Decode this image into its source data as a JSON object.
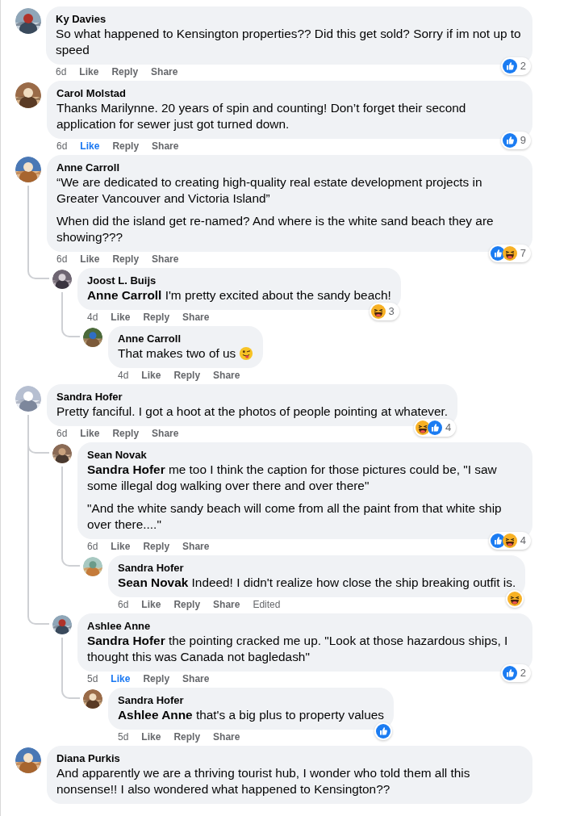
{
  "comments": [
    {
      "author": "Ky Davies",
      "paragraphs": [
        "So what happened to Kensington properties?? Did this get sold? Sorry if im not up to speed"
      ],
      "time": "6d",
      "like": "Like",
      "liked": false,
      "reply": "Reply",
      "share": "Share",
      "reactions": {
        "icons": [
          {
            "kind": "like"
          }
        ],
        "count": "2"
      }
    },
    {
      "author": "Carol Molstad",
      "paragraphs": [
        "Thanks Marilynne. 20 years of spin and counting! Don’t forget their second application for sewer just got turned down."
      ],
      "time": "6d",
      "like": "Like",
      "liked": true,
      "reply": "Reply",
      "share": "Share",
      "reactions": {
        "icons": [
          {
            "kind": "like"
          }
        ],
        "count": "9"
      }
    },
    {
      "author": "Anne Carroll",
      "paragraphs": [
        "“We are dedicated to creating high-quality real estate development projects in Greater Vancouver and Victoria Island”",
        "When did the island get re-named? And where is the white sand beach they are showing???"
      ],
      "time": "6d",
      "like": "Like",
      "liked": false,
      "reply": "Reply",
      "share": "Share",
      "reactions": {
        "icons": [
          {
            "kind": "like"
          },
          {
            "kind": "haha"
          }
        ],
        "count": "7"
      },
      "children": [
        {
          "author": "Joost L. Buijs",
          "paragraphs": [
            "**Anne Carroll** I'm pretty excited about the sandy beach!"
          ],
          "time": "4d",
          "like": "Like",
          "liked": false,
          "reply": "Reply",
          "share": "Share",
          "reactions": {
            "icons": [
              {
                "kind": "haha"
              }
            ],
            "count": "3"
          },
          "children": [
            {
              "author": "Anne Carroll",
              "paragraphs": [
                "That makes two of us"
              ],
              "emoji": {
                "kind": "wink"
              },
              "time": "4d",
              "like": "Like",
              "liked": false,
              "reply": "Reply",
              "share": "Share"
            }
          ]
        }
      ]
    },
    {
      "author": "Sandra Hofer",
      "paragraphs": [
        "Pretty fanciful. I got a hoot at the photos of people pointing at whatever."
      ],
      "time": "6d",
      "like": "Like",
      "liked": false,
      "reply": "Reply",
      "share": "Share",
      "reactions": {
        "icons": [
          {
            "kind": "haha"
          },
          {
            "kind": "like"
          }
        ],
        "count": "4"
      },
      "children": [
        {
          "author": "Sean Novak",
          "paragraphs": [
            "**Sandra Hofer** me too I think the caption for those pictures could be, \"I saw some illegal dog walking over there and over there\"",
            "\"And the white sandy beach will come from all the paint from that white ship over there....\""
          ],
          "time": "6d",
          "like": "Like",
          "liked": false,
          "reply": "Reply",
          "share": "Share",
          "reactions": {
            "icons": [
              {
                "kind": "like"
              },
              {
                "kind": "haha"
              }
            ],
            "count": "4"
          },
          "children": [
            {
              "author": "Sandra Hofer",
              "paragraphs": [
                "**Sean Novak** Indeed! I didn't realize how close the ship breaking outfit is."
              ],
              "time": "6d",
              "like": "Like",
              "liked": false,
              "reply": "Reply",
              "share": "Share",
              "edited": "Edited",
              "reactions": {
                "icons": [
                  {
                    "kind": "haha"
                  }
                ]
              }
            }
          ]
        },
        {
          "author": "Ashlee Anne",
          "paragraphs": [
            "**Sandra Hofer** the pointing cracked me up. \"Look at those hazardous ships, I thought this was Canada not bagledash\""
          ],
          "time": "5d",
          "like": "Like",
          "liked": true,
          "reply": "Reply",
          "share": "Share",
          "reactions": {
            "icons": [
              {
                "kind": "like"
              }
            ],
            "count": "2"
          },
          "children": [
            {
              "author": "Sandra Hofer",
              "paragraphs": [
                "**Ashlee Anne** that's a big plus to property values"
              ],
              "time": "5d",
              "like": "Like",
              "liked": false,
              "reply": "Reply",
              "share": "Share",
              "reactions": {
                "icons": [
                  {
                    "kind": "like"
                  }
                ]
              }
            }
          ]
        }
      ]
    },
    {
      "author": "Diana Purkis",
      "paragraphs": [
        "And apparently we are a thriving tourist hub, I wonder who told them all this nonsense!! I also wondered what happened to Kensington??"
      ]
    }
  ]
}
